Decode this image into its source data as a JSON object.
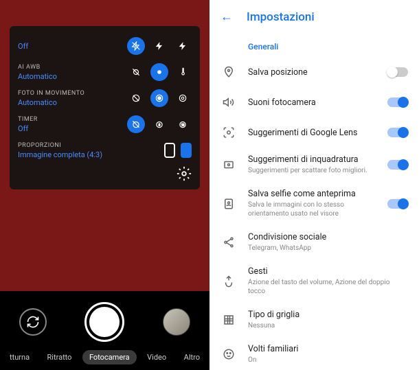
{
  "camera": {
    "flash": {
      "label": "",
      "value": "Off"
    },
    "awb": {
      "label": "AI AWB",
      "value": "Automatico"
    },
    "motion": {
      "label": "FOTO IN MOVIMENTO",
      "value": "Automatico"
    },
    "timer": {
      "label": "TIMER",
      "value": "Off"
    },
    "ratio": {
      "label": "PROPORZIONI",
      "value": "Immagine completa (4:3)"
    },
    "modes": [
      "tturna",
      "Ritratto",
      "Fotocamera",
      "Video",
      "Altro"
    ],
    "active_mode_index": 2
  },
  "settings": {
    "title": "Impostazioni",
    "section": "Generali",
    "items": [
      {
        "title": "Salva posizione",
        "sub": "",
        "toggle": "off",
        "icon": "location"
      },
      {
        "title": "Suoni fotocamera",
        "sub": "",
        "toggle": "on",
        "icon": "volume"
      },
      {
        "title": "Suggerimenti di Google Lens",
        "sub": "",
        "toggle": "on",
        "icon": "lens"
      },
      {
        "title": "Suggerimenti di inquadratura",
        "sub": "Suggerimenti per scattare foto migliori.",
        "toggle": "on",
        "icon": "frame"
      },
      {
        "title": "Salva selfie come anteprima",
        "sub": "Salva le immagini con lo stesso orientamento usato nel visore",
        "toggle": "on",
        "icon": "selfie"
      },
      {
        "title": "Condivisione sociale",
        "sub": "Telegram, WhatsApp",
        "toggle": "",
        "icon": "share"
      },
      {
        "title": "Gesti",
        "sub": "Azione del tasto del volume, Azione del doppio tocco",
        "toggle": "",
        "icon": "gesture"
      },
      {
        "title": "Tipo di griglia",
        "sub": "Nessuna",
        "toggle": "",
        "icon": "grid"
      },
      {
        "title": "Volti familiari",
        "sub": "On",
        "toggle": "",
        "icon": "face"
      }
    ]
  }
}
